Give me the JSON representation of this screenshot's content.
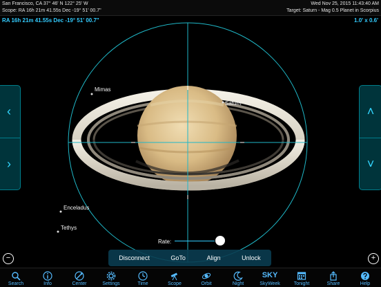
{
  "status": {
    "location": "San Francisco, CA  37° 46' N 122° 25' W",
    "datetime": "Wed Nov 25, 2015   11:43:40 AM",
    "scope": "Scope: RA 16h 21m 41.55s   Dec -19° 51' 00.7\"",
    "target": "Target: Saturn - Mag 0.5 Planet in Scorpius"
  },
  "readout": {
    "radec": "RA 16h 21m 41.55s Dec -19° 51' 00.7\"",
    "fov": "1.0' x 0.6'"
  },
  "sky_labels": {
    "mimas": "Mimas",
    "saturn": "Saturn",
    "enceladus": "Enceladus",
    "tethys": "Tethys"
  },
  "nav": {
    "left_up": "‹",
    "left_down": "›",
    "right_up": "˄",
    "right_down": "˅"
  },
  "rate": {
    "label": "Rate:"
  },
  "controls": {
    "disconnect": "Disconnect",
    "goto": "GoTo",
    "align": "Align",
    "unlock": "Unlock"
  },
  "zoom": {
    "out": "−",
    "in": "+"
  },
  "tabs": [
    {
      "label": "Search",
      "icon": "search-icon"
    },
    {
      "label": "Info",
      "icon": "info-icon"
    },
    {
      "label": "Center",
      "icon": "center-icon"
    },
    {
      "label": "Settings",
      "icon": "settings-icon"
    },
    {
      "label": "Time",
      "icon": "clock-icon"
    },
    {
      "label": "Scope",
      "icon": "telescope-icon"
    },
    {
      "label": "Orbit",
      "icon": "orbit-icon"
    },
    {
      "label": "Night",
      "icon": "moon-icon"
    },
    {
      "label": "SkyWeek",
      "icon": "skyweek-logo"
    },
    {
      "label": "Tonight",
      "icon": "calendar-icon"
    },
    {
      "label": "Share",
      "icon": "share-icon"
    },
    {
      "label": "Help",
      "icon": "help-icon"
    }
  ],
  "tab_logo_text": "SKY",
  "colors": {
    "accent": "#33ccff",
    "reticle": "#1fb8c8",
    "panel": "#0a3c50"
  }
}
